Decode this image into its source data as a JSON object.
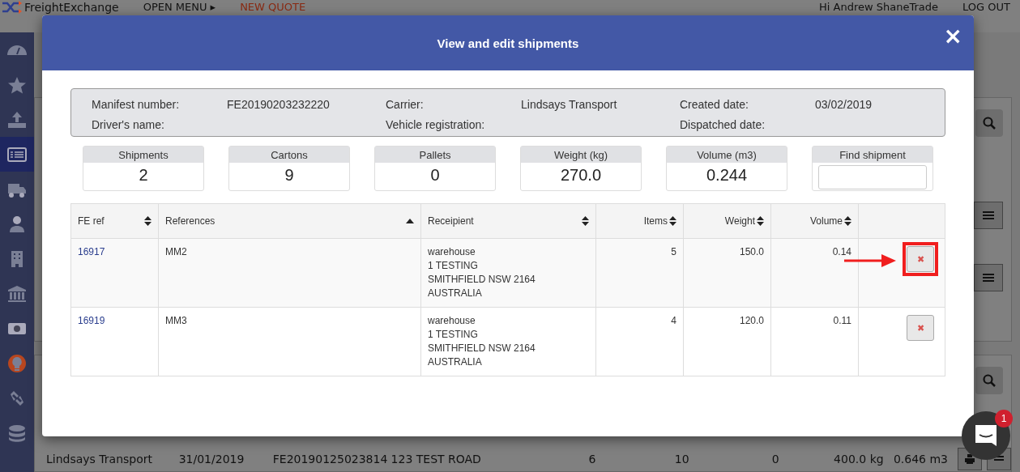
{
  "header": {
    "logo": "FreightExchange",
    "menu": "OPEN MENU ▸",
    "quote": "NEW QUOTE",
    "greeting": "Hi Andrew ShaneTrade",
    "logout": "LOG OUT"
  },
  "sidebar": {
    "items": [
      {
        "selected": false
      },
      {
        "selected": false
      },
      {
        "selected": false
      },
      {
        "selected": true
      },
      {
        "selected": false
      },
      {
        "selected": false
      },
      {
        "selected": false
      },
      {
        "selected": false
      },
      {
        "selected": false
      },
      {
        "selected": false,
        "color": "#b8461f"
      },
      {
        "selected": false
      },
      {
        "selected": false
      }
    ]
  },
  "background_row": {
    "cells": [
      "Lindsays Transport",
      "31/01/2019",
      "FE20190125023814",
      "123 TEST ROAD",
      "6",
      "10",
      "0",
      "400.0 kg",
      "0.646 m3"
    ]
  },
  "chat": {
    "badge": "1"
  },
  "modal": {
    "title": "View and edit shipments",
    "close": "×",
    "info": [
      {
        "label": "Manifest number:",
        "value": "FE20190203232220"
      },
      {
        "label": "Carrier:",
        "value": "Lindsays Transport"
      },
      {
        "label": "Created date:",
        "value": "03/02/2019"
      },
      {
        "label": "Driver's name:"
      },
      {
        "label": "Vehicle registration:"
      },
      {
        "label": "Dispatched date:"
      }
    ],
    "stats": [
      {
        "label": "Shipments",
        "value": "2"
      },
      {
        "label": "Cartons",
        "value": "9"
      },
      {
        "label": "Pallets",
        "value": "0"
      },
      {
        "label": "Weight (kg)",
        "value": "270.0"
      },
      {
        "label": "Volume (m3)",
        "value": "0.244"
      }
    ],
    "find": {
      "label": "Find shipment"
    },
    "table": {
      "columns": [
        {
          "label": "FE ref",
          "sorted_ascending": false
        },
        {
          "label": "References",
          "sorted_ascending": true
        },
        {
          "label": "Receipient",
          "sorted_ascending": false
        },
        {
          "label": "Items",
          "sorted_ascending": false
        },
        {
          "label": "Weight",
          "sorted_ascending": false
        },
        {
          "label": "Volume",
          "sorted_ascending": false
        }
      ],
      "rows": [
        {
          "fe_ref": "16917",
          "reference": "MM2",
          "recipient": [
            "warehouse",
            "1 TESTING",
            "SMITHFIELD NSW 2164",
            "AUSTRALIA"
          ],
          "items": "5",
          "weight": "150.0",
          "volume": "0.14",
          "remove": "✖",
          "highlighted": true
        },
        {
          "fe_ref": "16919",
          "reference": "MM3",
          "recipient": [
            "warehouse",
            "1 TESTING",
            "SMITHFIELD NSW 2164",
            "AUSTRALIA"
          ],
          "items": "4",
          "weight": "120.0",
          "volume": "0.11",
          "remove": "✖",
          "highlighted": false
        }
      ]
    }
  }
}
